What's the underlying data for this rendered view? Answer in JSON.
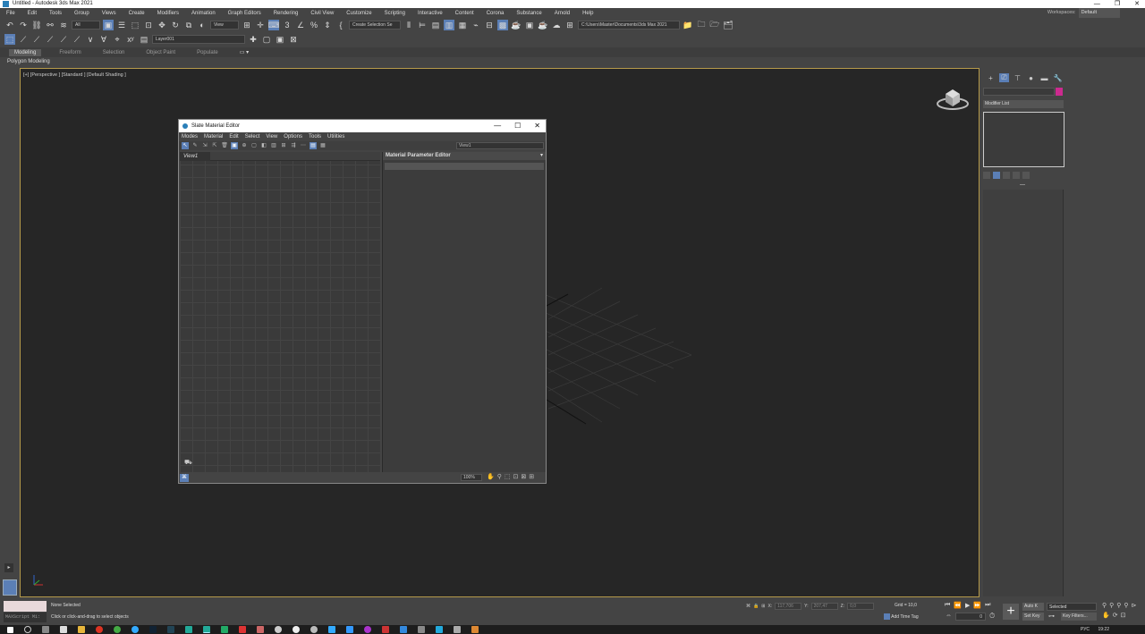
{
  "window": {
    "title": "Untitled - Autodesk 3ds Max 2021",
    "controls": [
      "—",
      "❐",
      "✕"
    ]
  },
  "menu": [
    "File",
    "Edit",
    "Tools",
    "Group",
    "Views",
    "Create",
    "Modifiers",
    "Animation",
    "Graph Editors",
    "Rendering",
    "Civil View",
    "Customize",
    "Scripting",
    "Interactive",
    "Content",
    "Corona",
    "Substance",
    "Arnold",
    "Help"
  ],
  "workspaces": {
    "label": "Workspaces:",
    "value": "Default"
  },
  "toolbar": {
    "filter_value": "All",
    "ref_coord_value": "View",
    "selection_set_value": "Create Selection Se",
    "project_path": "C:\\Users\\Master\\Documents\\3ds Max 2021",
    "layer_value": "Layer001"
  },
  "ribbon": {
    "tabs": [
      "Modeling",
      "Freeform",
      "Selection",
      "Object Paint",
      "Populate"
    ],
    "active": "Modeling",
    "sub_label": "Polygon Modeling"
  },
  "viewport": {
    "label": "[+] [Perspective ] [Standard ] [Default Shading ]"
  },
  "command_panel": {
    "modifier_list": "Modifier List",
    "color_swatch": "#cc2a8f"
  },
  "status": {
    "maxscript": "MAXScript Mi:",
    "selection": "None Selected",
    "prompt": "Click or click-and-drag to select objects",
    "x_label": "X:",
    "x_value": "117,706",
    "y_label": "Y:",
    "y_value": "207,47",
    "z_label": "Z:",
    "z_value": "0,0",
    "grid": "Grid = 10,0",
    "add_time_tag": "Add Time Tag",
    "frame": "0",
    "auto_key": "Auto K",
    "set_key": "Set Key",
    "selected_dd": "Selected",
    "key_filters": "Key Filters..."
  },
  "taskbar": {
    "lang": "РУС",
    "time": "19:22"
  },
  "slate": {
    "title": "Slate Material Editor",
    "menu": [
      "Modes",
      "Material",
      "Edit",
      "Select",
      "View",
      "Options",
      "Tools",
      "Utilities"
    ],
    "view_dropdown": "View1",
    "view_tab": "View1",
    "param_title": "Material Parameter Editor",
    "zoom": "100%"
  }
}
